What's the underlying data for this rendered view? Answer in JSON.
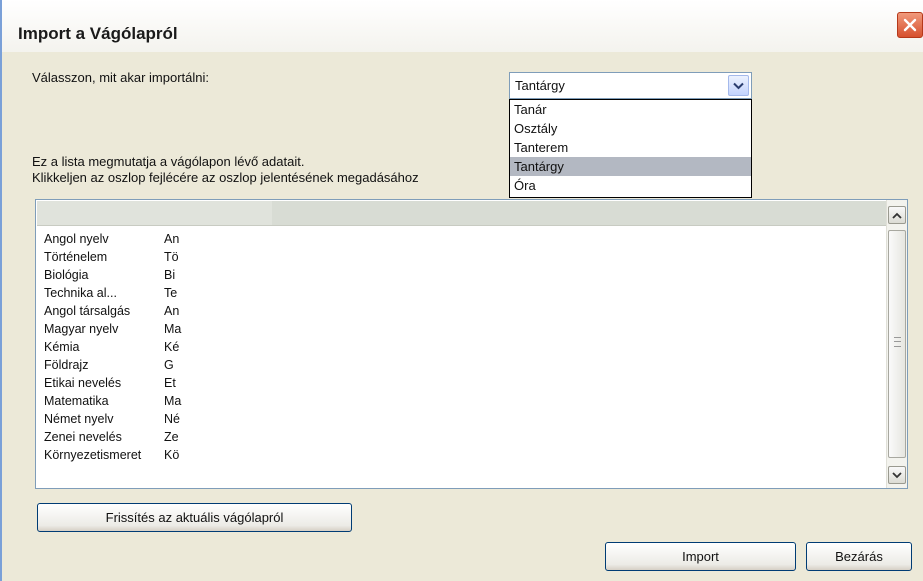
{
  "window": {
    "title": "Import a Vágólapról"
  },
  "prompt_label": "Válasszon, mit akar importálni:",
  "type_select": {
    "value": "Tantárgy",
    "options": [
      "Tanár",
      "Osztály",
      "Tanterem",
      "Tantárgy",
      "Óra"
    ],
    "selected_index": 3
  },
  "info": {
    "line1": "Ez a lista megmutatja a vágólapon lévő adatait.",
    "line2": "Klikkeljen az oszlop fejlécére az oszlop jelentésének megadásához"
  },
  "grid": {
    "rows": [
      {
        "name": "Angol nyelv",
        "code": "An"
      },
      {
        "name": "Történelem",
        "code": "Tö"
      },
      {
        "name": "Biológia",
        "code": "Bi"
      },
      {
        "name": "Technika al...",
        "code": "Te"
      },
      {
        "name": "Angol társalgás",
        "code": "An"
      },
      {
        "name": "Magyar nyelv",
        "code": "Ma"
      },
      {
        "name": "Kémia",
        "code": "Ké"
      },
      {
        "name": "Földrajz",
        "code": "G"
      },
      {
        "name": "Etikai nevelés",
        "code": "Et"
      },
      {
        "name": "Matematika",
        "code": "Ma"
      },
      {
        "name": "Német nyelv",
        "code": "Né"
      },
      {
        "name": "Zenei nevelés",
        "code": "Ze"
      },
      {
        "name": "Környezetismeret",
        "code": "Kö"
      }
    ]
  },
  "buttons": {
    "refresh": "Frissítés az aktuális vágólapról",
    "import": "Import",
    "close": "Bezárás"
  },
  "colors": {
    "dialog_bg": "#ece9d8",
    "close_button": "#d6502e",
    "selected_option": "#b3b8c2"
  }
}
